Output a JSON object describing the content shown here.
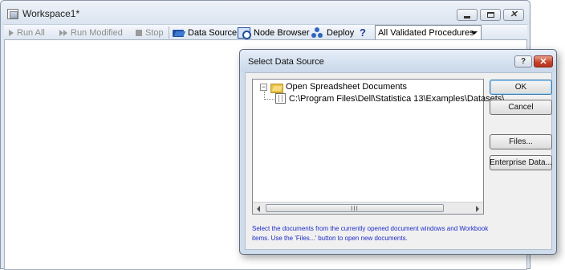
{
  "workspace": {
    "title": "Workspace1*"
  },
  "toolbar": {
    "run_all": "Run All",
    "run_modified": "Run Modified",
    "stop": "Stop",
    "data_source": "Data Source",
    "node_browser": "Node Browser",
    "deploy": "Deploy",
    "help": "?",
    "procedures_select": "All Validated Procedures"
  },
  "dialog": {
    "title": "Select Data Source",
    "help_button": "?",
    "close_button": "✕",
    "tree": {
      "root_label": "Open Spreadsheet Documents",
      "child_label": "C:\\Program Files\\Dell\\Statistica 13\\Examples\\Datasets\\"
    },
    "scroll_thumb_grip": "III",
    "buttons": {
      "ok": "OK",
      "cancel": "Cancel",
      "files": "Files...",
      "enterprise": "Enterprise Data..."
    },
    "hint": "Select the documents from the currently opened document windows and Workbook items. Use the 'Files...' button to open new documents."
  },
  "colors": {
    "accent": "#1f4f9e",
    "hint_text": "#1f2cc8",
    "close_red": "#c7442c"
  }
}
